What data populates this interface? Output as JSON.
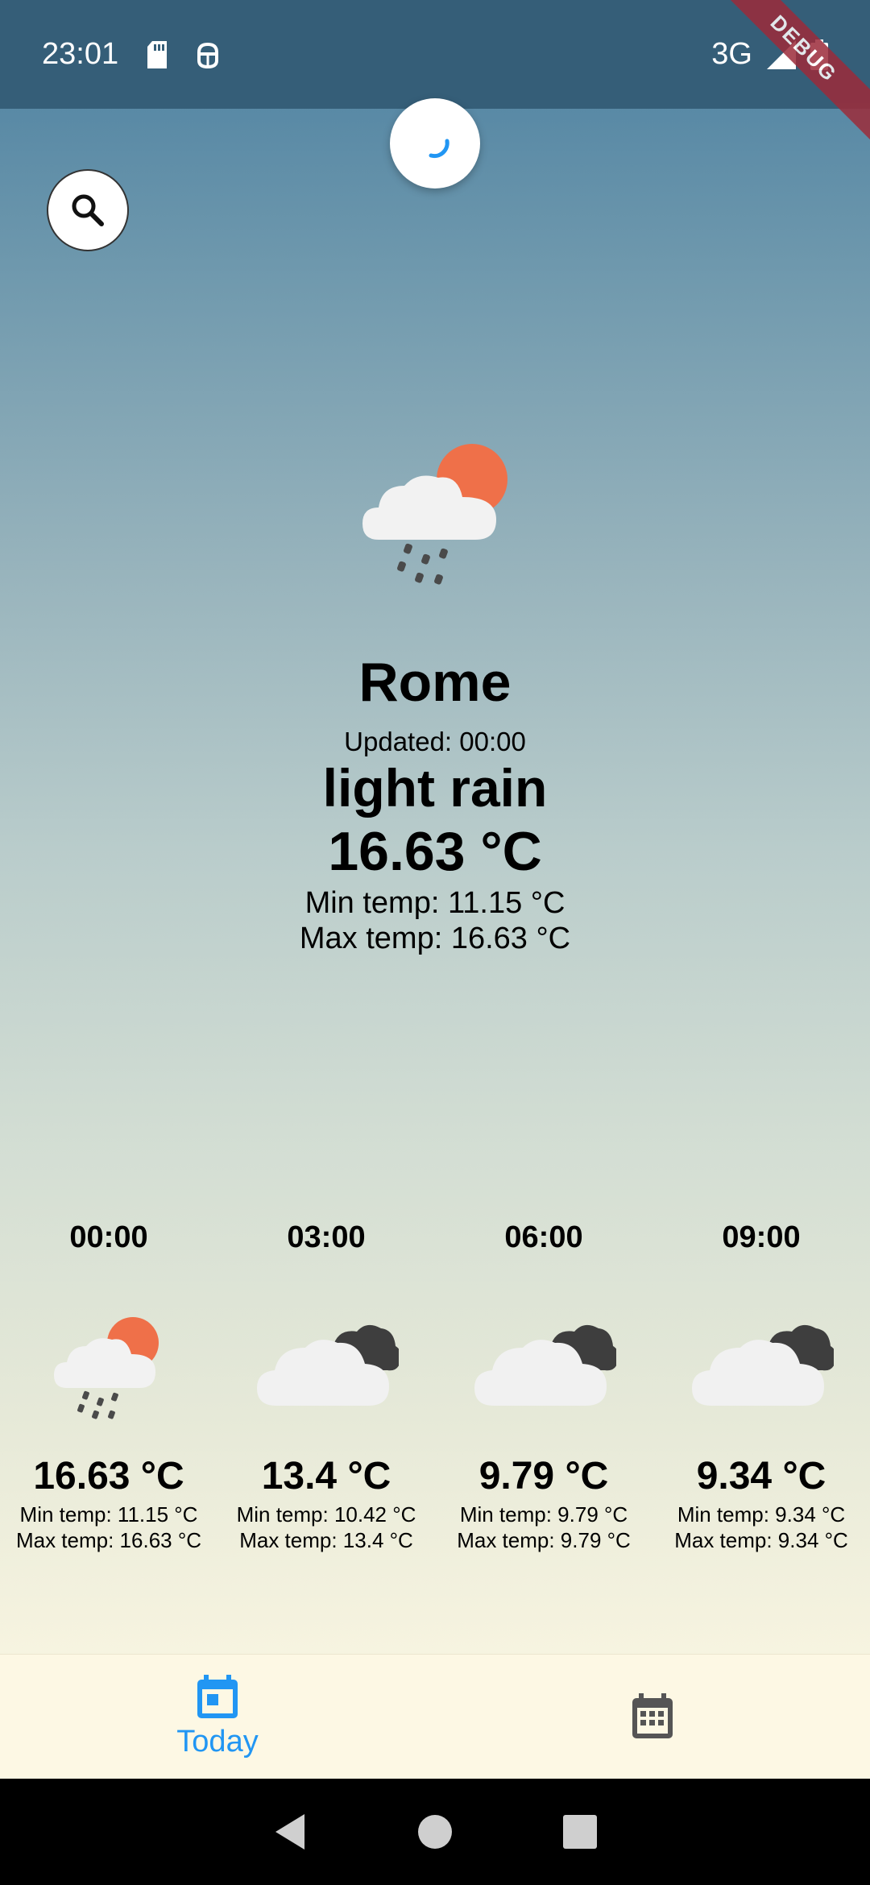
{
  "status_bar": {
    "time": "23:01",
    "network": "3G",
    "icons": [
      "sd-card-icon",
      "android-debug-icon",
      "signal-icon",
      "battery-icon"
    ]
  },
  "debug_banner": "DEBUG",
  "current": {
    "city": "Rome",
    "updated": "Updated: 00:00",
    "description": "light rain",
    "temperature": "16.63 °C",
    "min_temp": "Min temp: 11.15 °C",
    "max_temp": "Max temp: 16.63 °C",
    "icon": "light-rain-sun-icon"
  },
  "forecast": [
    {
      "time": "00:00",
      "temp": "16.63 °C",
      "min": "Min temp: 11.15 °C",
      "max": "Max temp: 16.63 °C",
      "icon": "light-rain-sun-icon"
    },
    {
      "time": "03:00",
      "temp": "13.4 °C",
      "min": "Min temp: 10.42 °C",
      "max": "Max temp: 13.4 °C",
      "icon": "overcast-clouds-icon"
    },
    {
      "time": "06:00",
      "temp": "9.79 °C",
      "min": "Min temp: 9.79 °C",
      "max": "Max temp: 9.79 °C",
      "icon": "overcast-clouds-icon"
    },
    {
      "time": "09:00",
      "temp": "9.34 °C",
      "min": "Min temp: 9.34 °C",
      "max": "Max temp: 9.34 °C",
      "icon": "overcast-clouds-icon"
    }
  ],
  "bottom_nav": {
    "today_label": "Today",
    "active": "today"
  },
  "colors": {
    "accent": "#2196f3",
    "status_bar": "#355e78",
    "sun": "#ef7049"
  }
}
